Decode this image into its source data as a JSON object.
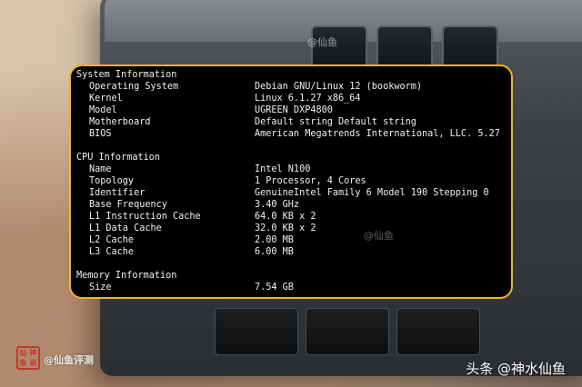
{
  "terminal": {
    "system": {
      "heading": "System Information",
      "rows": [
        {
          "label": "Operating System",
          "value": "Debian GNU/Linux 12 (bookworm)"
        },
        {
          "label": "Kernel",
          "value": "Linux 6.1.27 x86_64"
        },
        {
          "label": "Model",
          "value": "UGREEN DXP4800"
        },
        {
          "label": "Motherboard",
          "value": "Default string Default string"
        },
        {
          "label": "BIOS",
          "value": "American Megatrends International, LLC. 5.27"
        }
      ]
    },
    "cpu": {
      "heading": "CPU Information",
      "rows": [
        {
          "label": "Name",
          "value": "Intel N100"
        },
        {
          "label": "Topology",
          "value": "1 Processor, 4 Cores"
        },
        {
          "label": "Identifier",
          "value": "GenuineIntel Family 6 Model 190 Stepping 0"
        },
        {
          "label": "Base Frequency",
          "value": "3.40 GHz"
        },
        {
          "label": "L1 Instruction Cache",
          "value": "64.0 KB x 2"
        },
        {
          "label": "L1 Data Cache",
          "value": "32.0 KB x 2"
        },
        {
          "label": "L2 Cache",
          "value": "2.00 MB"
        },
        {
          "label": "L3 Cache",
          "value": "6.00 MB"
        }
      ]
    },
    "memory": {
      "heading": "Memory Information",
      "rows": [
        {
          "label": "Size",
          "value": "7.54 GB"
        }
      ]
    },
    "watermark": "@仙鱼"
  },
  "photo_watermark": "@仙鱼",
  "brand": {
    "seal_chars": [
      "仙",
      "神",
      "鱼",
      "说"
    ],
    "text": "@仙鱼评测"
  },
  "source_mark": "头条 @神水仙鱼",
  "colors": {
    "accent_border": "#f1b71c",
    "terminal_bg": "#000000",
    "terminal_text": "#ecf2f7"
  }
}
